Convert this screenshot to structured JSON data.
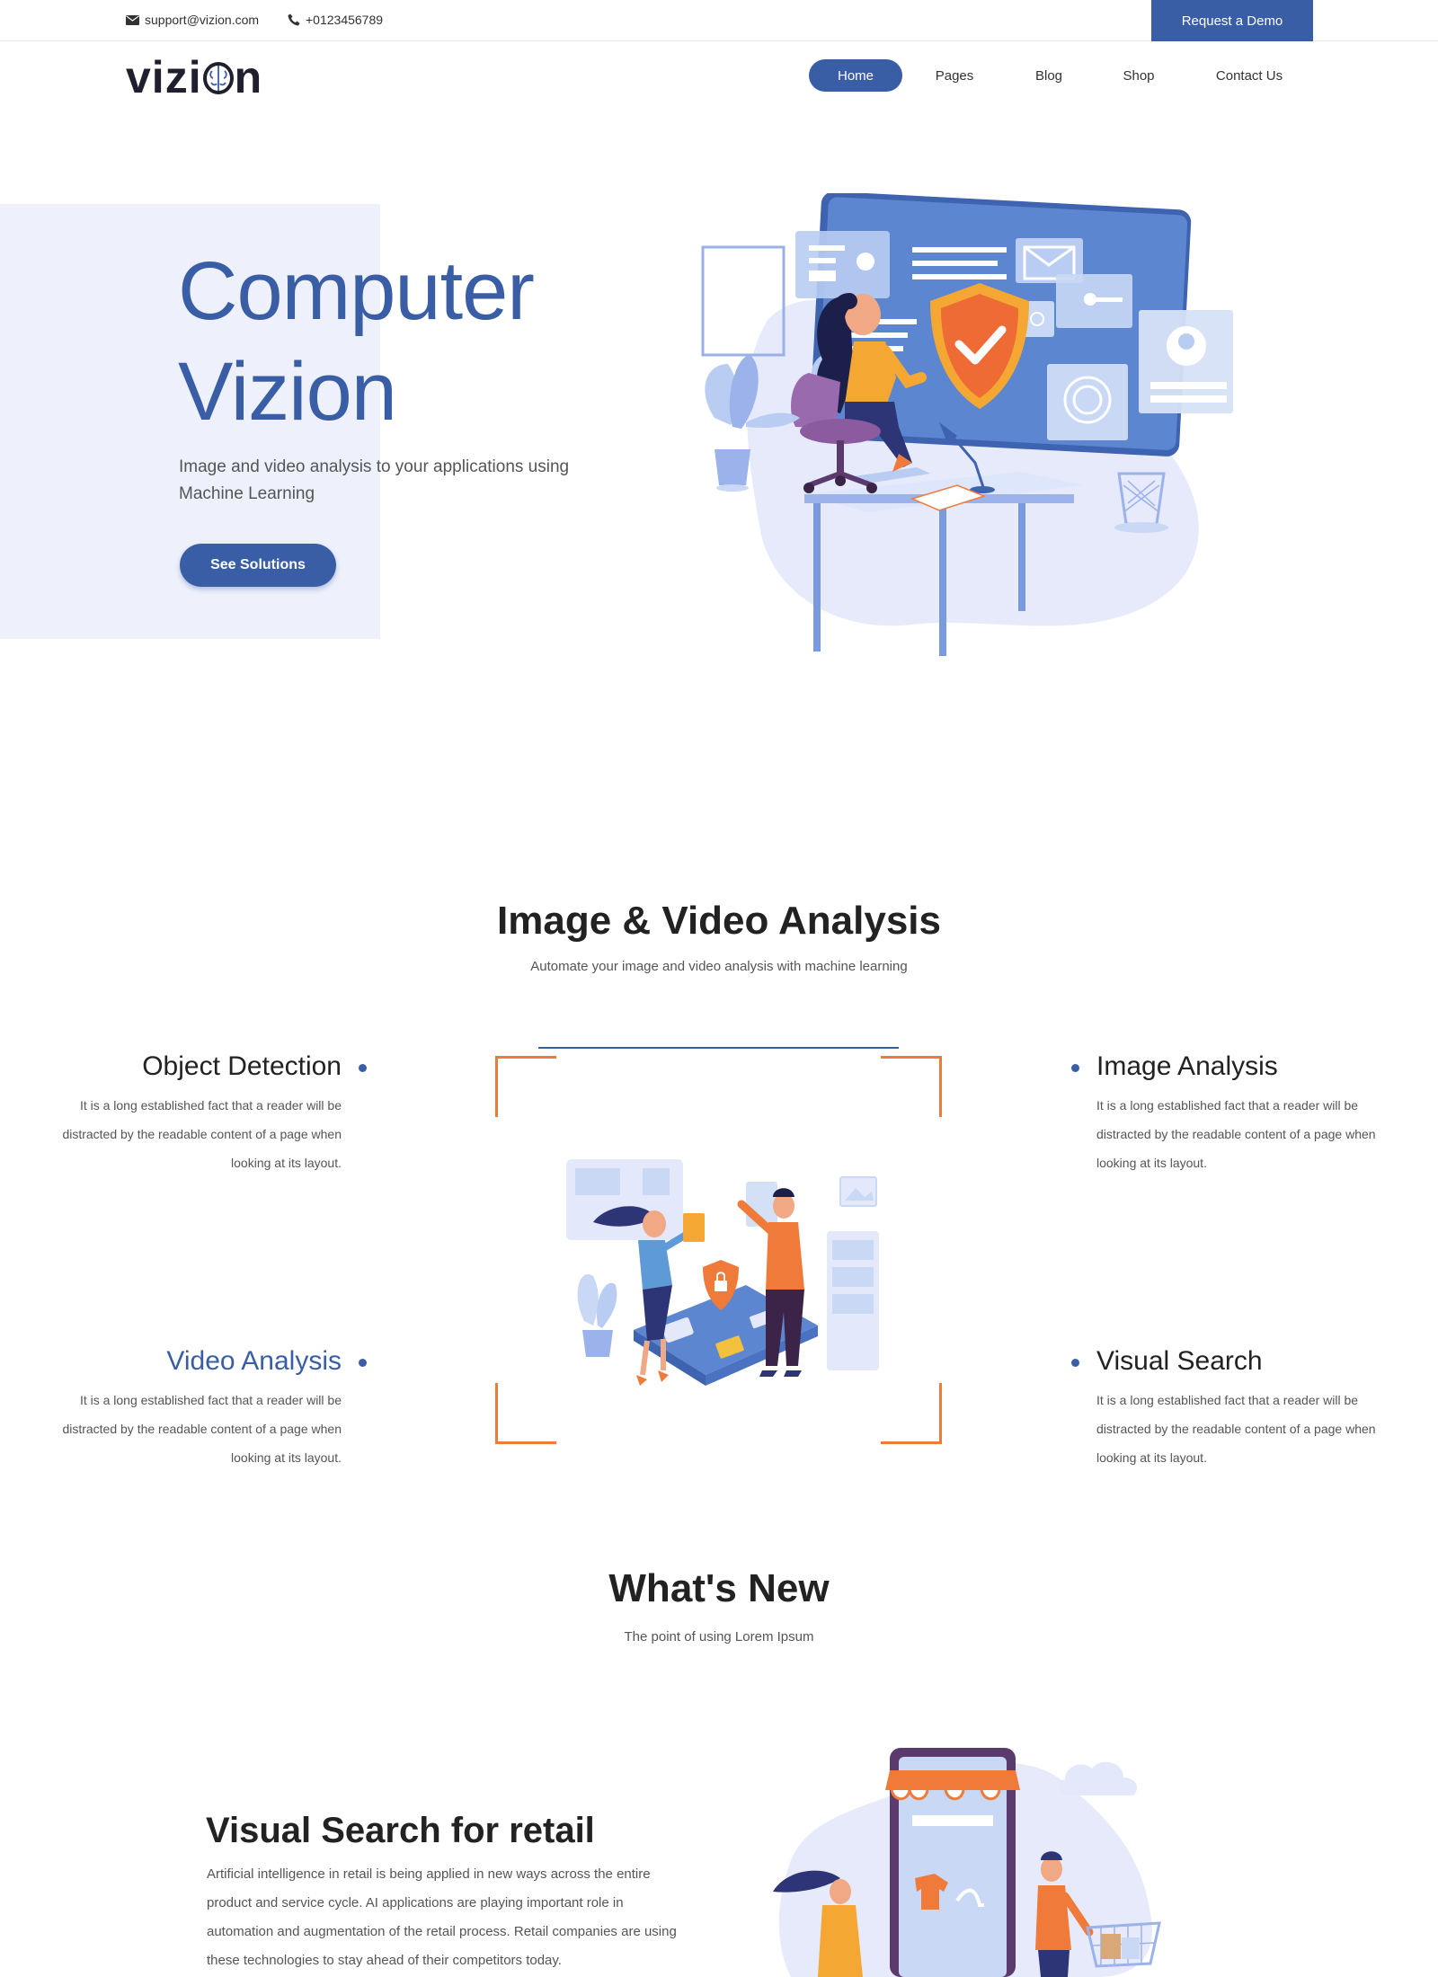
{
  "topbar": {
    "email": "support@vizion.com",
    "phone": "+0123456789",
    "demo_label": "Request a Demo"
  },
  "logo": {
    "text_left": "vizi",
    "text_right": "n"
  },
  "nav": {
    "items": [
      {
        "label": "Home",
        "active": true
      },
      {
        "label": "Pages"
      },
      {
        "label": "Blog"
      },
      {
        "label": "Shop"
      },
      {
        "label": "Contact Us"
      }
    ]
  },
  "hero": {
    "title_line1": "Computer",
    "title_line2": "Vizion",
    "subtitle": "Image and video analysis to your applications using Machine Learning",
    "button_label": "See Solutions"
  },
  "analysis": {
    "title": "Image & Video Analysis",
    "subtitle": "Automate your image and video analysis with machine learning",
    "features": [
      {
        "title": "Object Detection",
        "text": "It is a long established fact that a reader will be distracted by the readable content of a page when looking at its layout."
      },
      {
        "title": "Image Analysis",
        "text": "It is a long established fact that a reader will be distracted by the readable content of a page when looking at its layout."
      },
      {
        "title": "Video Analysis",
        "text": "It is a long established fact that a reader will be distracted by the readable content of a page when looking at its layout."
      },
      {
        "title": "Visual Search",
        "text": "It is a long established fact that a reader will be distracted by the readable content of a page when looking at its layout."
      }
    ]
  },
  "whats_new": {
    "title": "What's New",
    "subtitle": "The point of using Lorem Ipsum"
  },
  "retail": {
    "title": "Visual Search for retail",
    "text": "Artificial intelligence in retail is being applied in new ways across the entire product and service cycle. AI applications are playing important role in automation and augmentation of the retail process. Retail companies are using these technologies to stay ahead of their competitors today."
  },
  "colors": {
    "brand": "#3a5ea6",
    "accent": "#f07a3a",
    "hero_bg": "#eef1fc"
  }
}
